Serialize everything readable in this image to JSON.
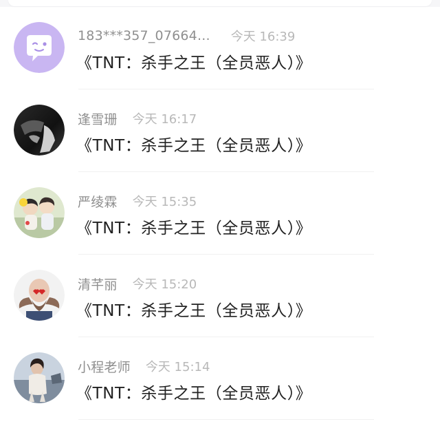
{
  "comments": [
    {
      "username": "183***357_07664...",
      "time": "今天 16:39",
      "text": "《TNT：杀手之王（全员恶人）》",
      "avatar": "default-avatar"
    },
    {
      "username": "逢雪珊",
      "time": "今天 16:17",
      "text": "《TNT：杀手之王（全员恶人）》",
      "avatar": "dark-photo-avatar"
    },
    {
      "username": "严绫霖",
      "time": "今天 15:35",
      "text": "《TNT：杀手之王（全员恶人）》",
      "avatar": "cartoon-couple-avatar"
    },
    {
      "username": "清芊丽",
      "time": "今天 15:20",
      "text": "《TNT：杀手之王（全员恶人）》",
      "avatar": "bearded-man-avatar"
    },
    {
      "username": "小程老师",
      "time": "今天 15:14",
      "text": "《TNT：杀手之王（全员恶人）》",
      "avatar": "woman-seaside-avatar"
    }
  ],
  "colors": {
    "username": "#8f8f8f",
    "timestamp": "#b8b8b8",
    "text": "#222222",
    "default_avatar_bg": "#c9b6f2"
  }
}
